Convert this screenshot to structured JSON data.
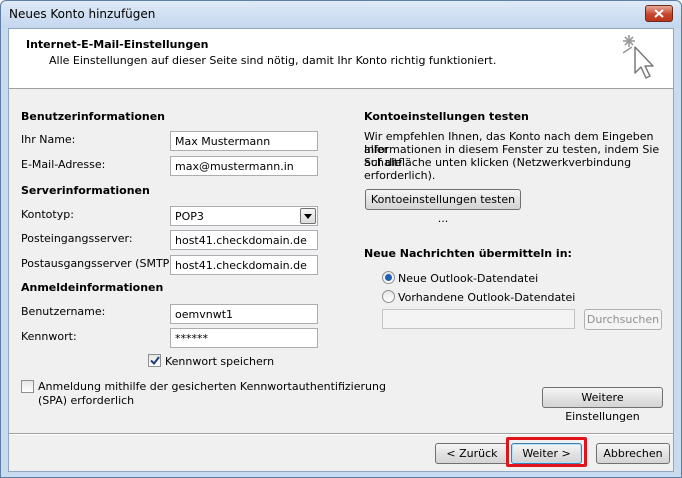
{
  "window": {
    "title": "Neues Konto hinzufügen"
  },
  "header": {
    "title": "Internet-E-Mail-Einstellungen",
    "subtitle": "Alle Einstellungen auf dieser Seite sind nötig, damit Ihr Konto richtig funktioniert.",
    "icon": "cursor-sparkle-icon"
  },
  "user_info": {
    "section_title": "Benutzerinformationen",
    "name_label": "Ihr Name:",
    "name_value": "Max Mustermann",
    "email_label": "E-Mail-Adresse:",
    "email_value": "max@mustermann.in"
  },
  "server_info": {
    "section_title": "Serverinformationen",
    "account_type_label": "Kontotyp:",
    "account_type_value": "POP3",
    "incoming_label": "Posteingangsserver:",
    "incoming_value": "host41.checkdomain.de",
    "outgoing_label": "Postausgangsserver (SMTP):",
    "outgoing_value": "host41.checkdomain.de"
  },
  "login_info": {
    "section_title": "Anmeldeinformationen",
    "username_label": "Benutzername:",
    "username_value": "oemvnwt1",
    "password_label": "Kennwort:",
    "password_value": "******",
    "remember_label": "Kennwort speichern",
    "remember_checked": true,
    "spa_label_line1": "Anmeldung mithilfe der gesicherten Kennwortauthentifizierung",
    "spa_label_line2": "(SPA) erforderlich",
    "spa_checked": false
  },
  "test_settings": {
    "section_title": "Kontoeinstellungen testen",
    "description_line1": "Wir empfehlen Ihnen, das Konto nach dem Eingeben aller",
    "description_line2": "Informationen in diesem Fenster zu testen, indem Sie auf die",
    "description_line3": "Schaltfläche unten klicken (Netzwerkverbindung erforderlich).",
    "test_button": "Kontoeinstellungen testen ..."
  },
  "deliver": {
    "section_title": "Neue Nachrichten übermitteln in:",
    "option_new": "Neue Outlook-Datendatei",
    "option_existing": "Vorhandene Outlook-Datendatei",
    "selected": "new",
    "path_value": "",
    "browse_button": "Durchsuchen"
  },
  "more_settings_button": "Weitere Einstellungen",
  "footer": {
    "back_button": "< Zurück",
    "next_button": "Weiter >",
    "cancel_button": "Abbrechen"
  },
  "colors": {
    "highlight": "#e0141a",
    "radio_dot": "#1c5fb3"
  }
}
